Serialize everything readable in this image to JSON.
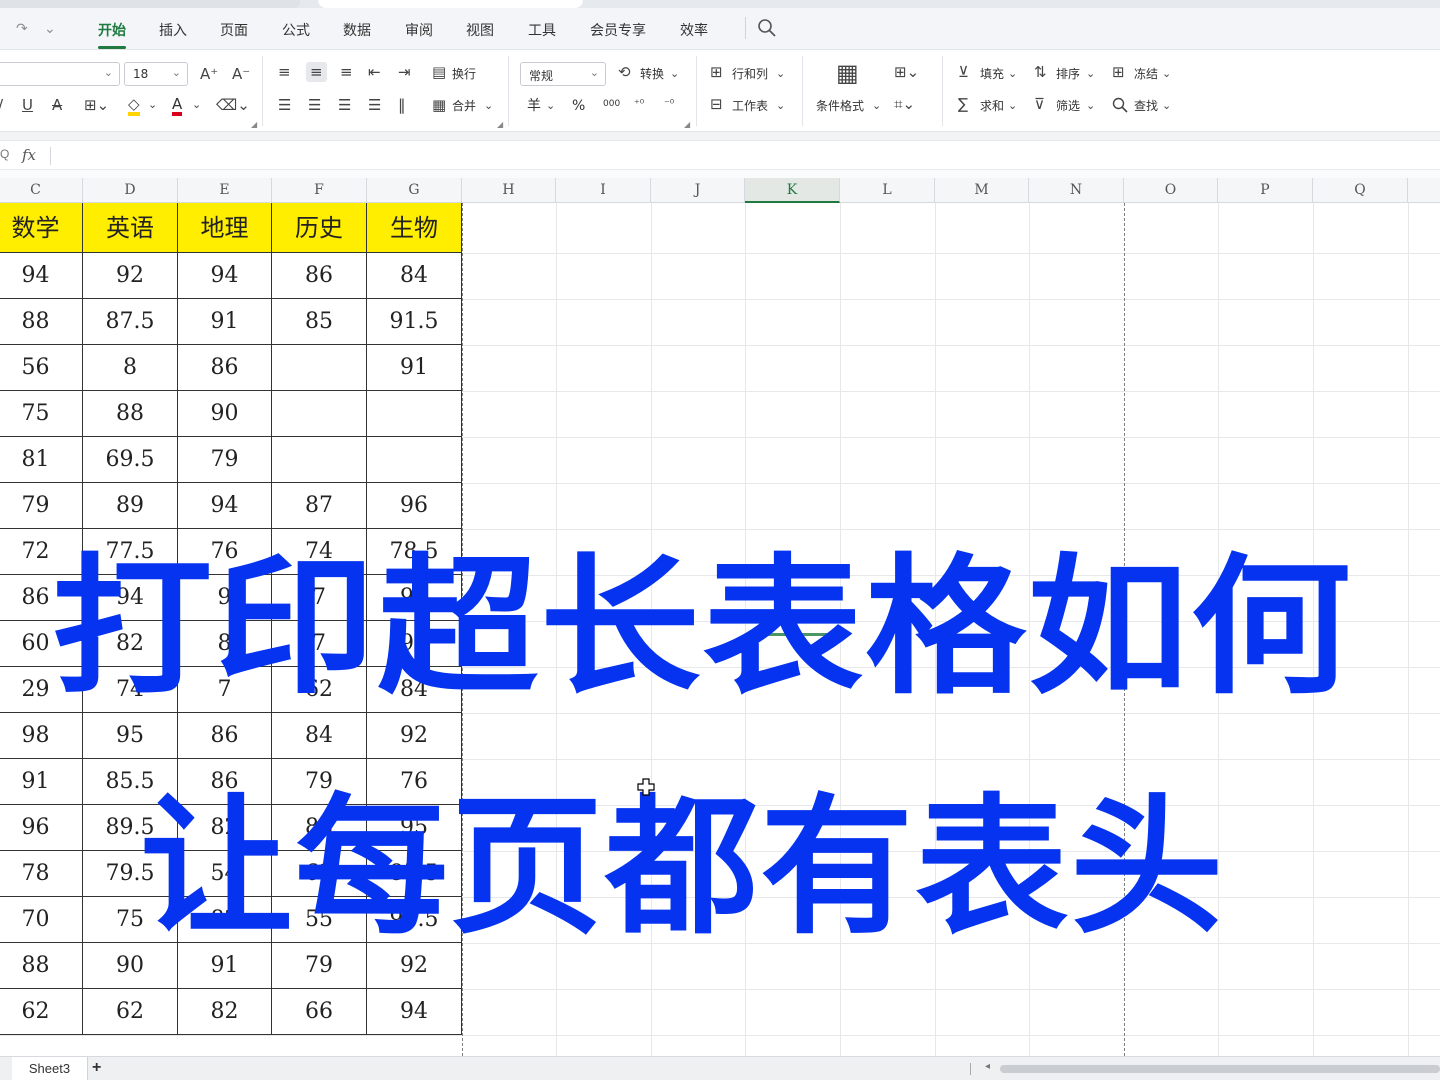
{
  "quick_access": {
    "redo_icon": "redo-icon",
    "more_icon": "chevron-down-icon"
  },
  "menu": {
    "items": [
      "开始",
      "插入",
      "页面",
      "公式",
      "数据",
      "审阅",
      "视图",
      "工具",
      "会员专享",
      "效率"
    ],
    "active_index": 0
  },
  "toolbar": {
    "font_name": "",
    "font_size": "18",
    "number_format": "常规",
    "wrap_text": "换行",
    "merge": "合并",
    "convert": "转换",
    "row_col": "行和列",
    "worksheet": "工作表",
    "conditional_format": "条件格式",
    "fill": "填充",
    "sort": "排序",
    "freeze": "冻结",
    "sum": "求和",
    "filter": "筛选",
    "find": "查找",
    "currency_symbol": "羊",
    "percent_symbol": "%",
    "thousands_symbol": "000",
    "font_color": "#d9001b",
    "highlight_color": "#ffd400",
    "accent_color": "#1f7a3f"
  },
  "formula_bar": {
    "fx_label": "fx",
    "content": ""
  },
  "columns": [
    "C",
    "D",
    "E",
    "F",
    "G",
    "H",
    "I",
    "J",
    "K",
    "L",
    "M",
    "N",
    "O",
    "P",
    "Q"
  ],
  "selected_column": "K",
  "table": {
    "headers": [
      "数学",
      "英语",
      "地理",
      "历史",
      "生物"
    ],
    "header_bg": "#ffee00",
    "rows": [
      [
        "94",
        "92",
        "94",
        "86",
        "84"
      ],
      [
        "88",
        "87.5",
        "91",
        "85",
        "91.5"
      ],
      [
        "56",
        "8",
        "86",
        "",
        "91"
      ],
      [
        "75",
        "88",
        "90",
        "",
        ""
      ],
      [
        "81",
        "69.5",
        "79",
        "",
        ""
      ],
      [
        "79",
        "89",
        "94",
        "87",
        "96"
      ],
      [
        "72",
        "77.5",
        "76",
        "74",
        "78.5"
      ],
      [
        "86",
        "94",
        "9",
        "7",
        "91"
      ],
      [
        "60",
        "82",
        "8",
        "7",
        "96"
      ],
      [
        "29",
        "74",
        "7",
        "62",
        "84"
      ],
      [
        "98",
        "95",
        "86",
        "84",
        "92"
      ],
      [
        "91",
        "85.5",
        "86",
        "79",
        "76"
      ],
      [
        "96",
        "89.5",
        "82",
        "88",
        "95"
      ],
      [
        "78",
        "79.5",
        "54",
        "62",
        "85.5"
      ],
      [
        "70",
        "75",
        "82",
        "55",
        "96.5"
      ],
      [
        "88",
        "90",
        "91",
        "79",
        "92"
      ],
      [
        "62",
        "62",
        "82",
        "66",
        "94"
      ]
    ]
  },
  "overlay": {
    "line1": "打印超长表格如何",
    "line2": "让每页都有表头",
    "color": "#0533f0"
  },
  "sheets": {
    "tabs": [
      "Sheet3"
    ],
    "add_label": "+"
  }
}
